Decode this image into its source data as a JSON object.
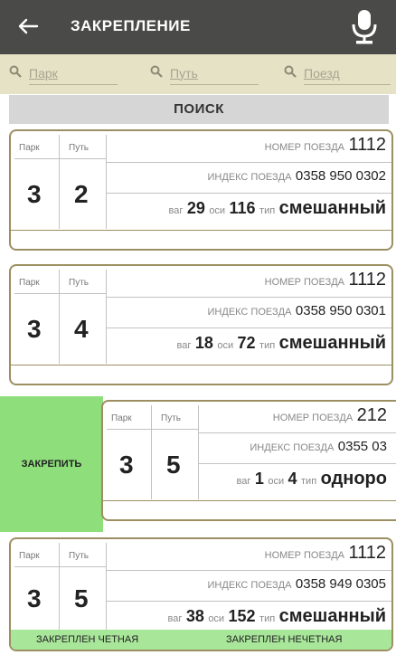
{
  "appbar": {
    "title": "ЗАКРЕПЛЕНИЕ",
    "back_icon": "arrow-left-icon",
    "mic_icon": "microphone-icon"
  },
  "search": {
    "park_placeholder": "Парк",
    "track_placeholder": "Путь",
    "train_placeholder": "Поезд",
    "button_label": "ПОИСК"
  },
  "labels": {
    "park": "Парк",
    "track": "Путь",
    "train_number": "НОМЕР ПОЕЗДА",
    "train_index": "ИНДЕКС ПОЕЗДА",
    "wagons": "ваг",
    "axles": "оси",
    "type": "тип"
  },
  "trains": [
    {
      "park": "3",
      "track": "2",
      "number": "1112",
      "index": "0358 950 0302",
      "wagons": "29",
      "axles": "116",
      "type": "смешанный"
    },
    {
      "park": "3",
      "track": "4",
      "number": "1112",
      "index": "0358 950 0301",
      "wagons": "18",
      "axles": "72",
      "type": "смешанный"
    },
    {
      "park": "3",
      "track": "5",
      "number": "212",
      "index": "0355 03",
      "wagons": "1",
      "axles": "4",
      "type": "одноро"
    },
    {
      "park": "3",
      "track": "5",
      "number": "1112",
      "index": "0358 949 0305",
      "wagons": "38",
      "axles": "152",
      "type": "смешанный"
    }
  ],
  "swipe_action_label": "ЗАКРЕПИТЬ",
  "status": {
    "even": "ЗАКРЕПЛЕН ЧЕТНАЯ",
    "odd": "ЗАКРЕПЛЕН НЕЧЕТНАЯ"
  },
  "colors": {
    "appbar": "#4a4a48",
    "searchbar": "#e6e2c6",
    "card_border": "#9c8f62",
    "swipe_action": "#8ede7c",
    "status_bar": "#a8e69a"
  }
}
